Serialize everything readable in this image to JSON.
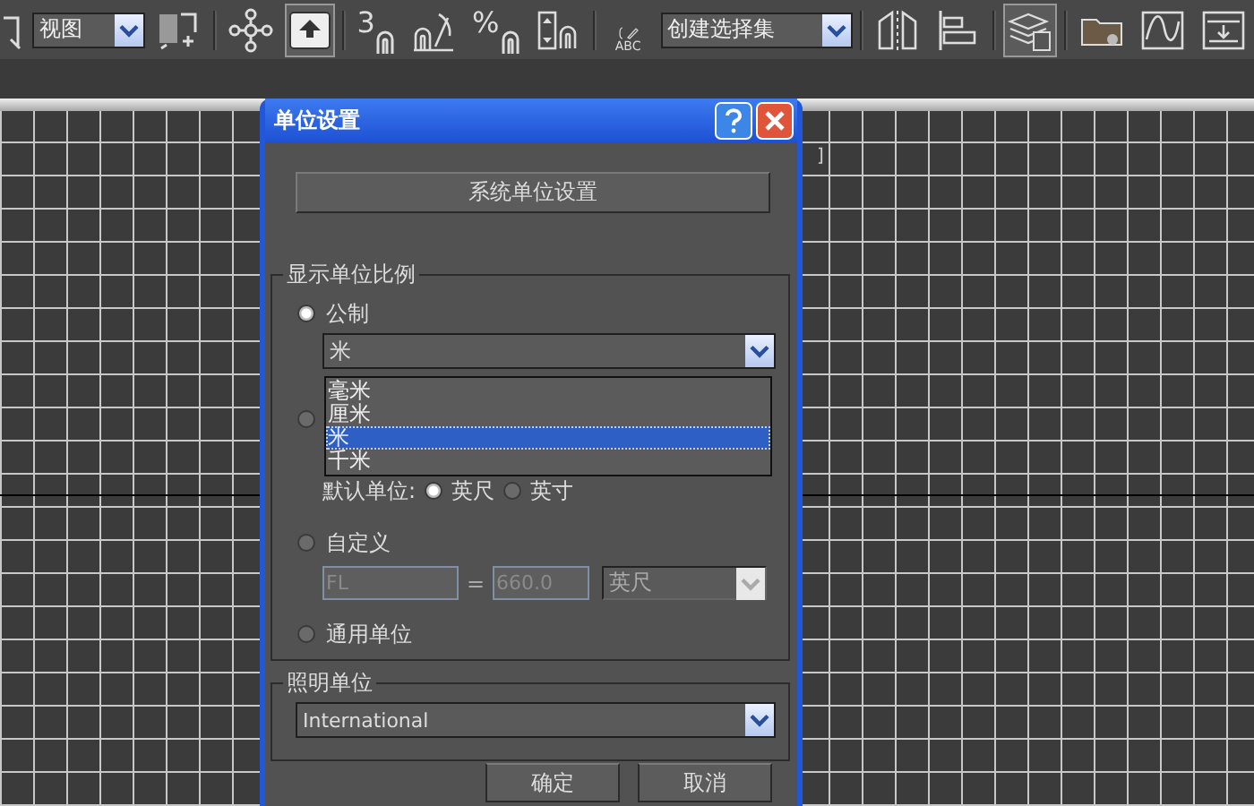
{
  "toolbar": {
    "view_dropdown": "视图",
    "selection_set_dropdown": "创建选择集",
    "snap_label": "3",
    "percent_label": "%",
    "abc_label": "ABC",
    "buttons": [
      {
        "selected": false
      },
      {
        "selected": false
      },
      {
        "selected": false
      },
      {
        "selected": true
      },
      {
        "selected": false
      },
      {
        "selected": false
      },
      {
        "selected": false
      },
      {
        "selected": false
      },
      {
        "selected": false
      },
      {
        "selected": false
      },
      {
        "selected": false
      },
      {
        "selected": true
      },
      {
        "selected": false
      },
      {
        "selected": false
      }
    ]
  },
  "viewport": {
    "label": "]"
  },
  "dialog": {
    "title": "单位设置",
    "system_button": "系统单位设置",
    "display_group": {
      "title": "显示单位比例",
      "metric": {
        "label": "公制",
        "selected": true,
        "value": "米",
        "list": [
          {
            "label": "毫米",
            "selected": false
          },
          {
            "label": "厘米",
            "selected": false
          },
          {
            "label": "米",
            "selected": true
          },
          {
            "label": "千米",
            "selected": false
          }
        ]
      },
      "covered_option": {
        "selected": false
      },
      "default_unit": {
        "label": "默认单位:",
        "options": [
          {
            "label": "英尺",
            "selected": true
          },
          {
            "label": "英寸",
            "selected": false
          }
        ]
      },
      "custom": {
        "label": "自定义",
        "selected": false,
        "name_value": "FL",
        "equals": "=",
        "amount_value": "660.0",
        "unit_value": "英尺"
      },
      "generic": {
        "label": "通用单位",
        "selected": false
      }
    },
    "lighting_group": {
      "title": "照明单位",
      "value": "International"
    },
    "buttons": [
      "确定",
      "取消"
    ]
  }
}
